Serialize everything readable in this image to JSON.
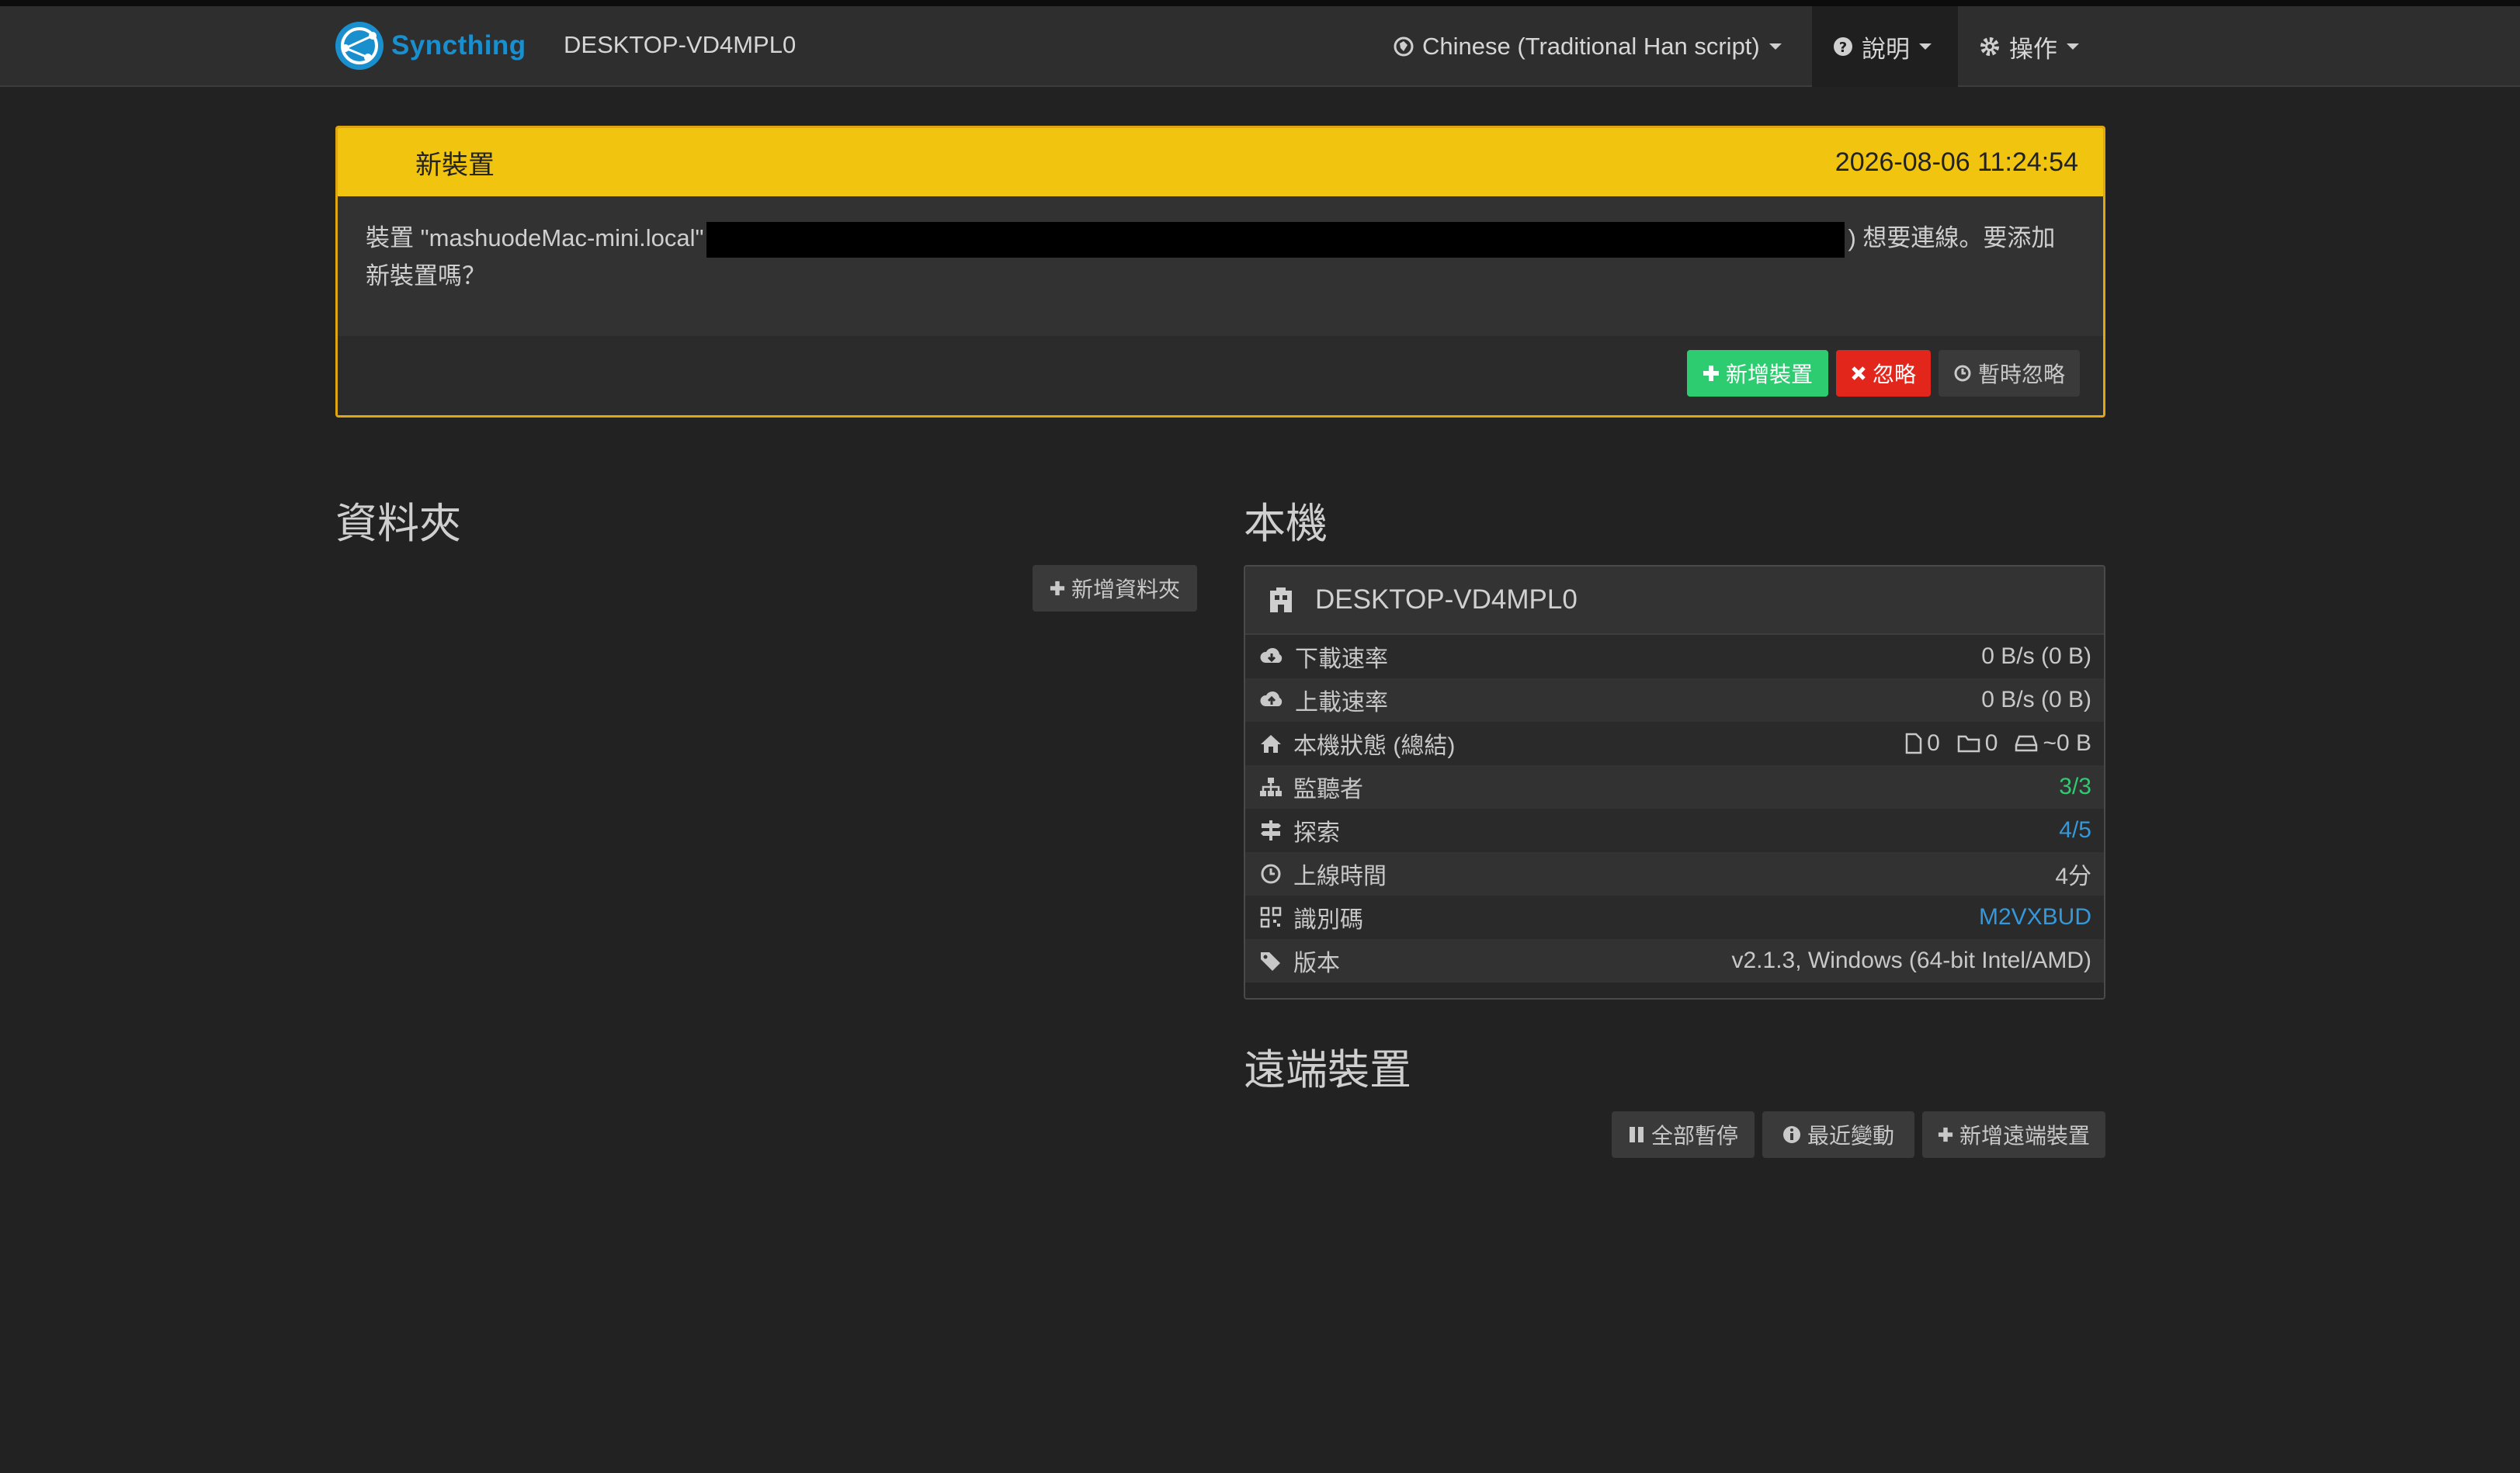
{
  "navbar": {
    "brand": "Syncthing",
    "host": "DESKTOP-VD4MPL0",
    "language_label": "Chinese (Traditional Han script)",
    "help_label": "說明",
    "actions_label": "操作"
  },
  "notice": {
    "title": "新裝置",
    "timestamp": "2026-08-06 11:24:54",
    "message_prefix": "裝置 \"mashuodeMac-mini.local\"",
    "message_suffix": ") 想要連線。要添加",
    "message_line2": "新裝置嗎？",
    "add_button": "新增裝置",
    "ignore_button": "忽略",
    "dismiss_button": "暫時忽略"
  },
  "folders": {
    "heading": "資料夾",
    "add_button": "新增資料夾"
  },
  "this_device": {
    "heading": "本機",
    "name": "DESKTOP-VD4MPL0",
    "rows": [
      {
        "label": "下載速率",
        "value": "0 B/s (0 B)",
        "icon": "cloud-download-icon"
      },
      {
        "label": "上載速率",
        "value": "0 B/s (0 B)",
        "icon": "cloud-upload-icon"
      },
      {
        "label": "本機狀態 (總結)",
        "icon": "home-icon",
        "files": "0",
        "dirs": "0",
        "size": "~0 B"
      },
      {
        "label": "監聽者",
        "value": "3/3",
        "icon": "sitemap-icon"
      },
      {
        "label": "探索",
        "value": "4/5",
        "icon": "signpost-icon"
      },
      {
        "label": "上線時間",
        "value": "4分",
        "icon": "clock-icon"
      },
      {
        "label": "識別碼",
        "value": "M2VXBUD",
        "icon": "qrcode-icon"
      },
      {
        "label": "版本",
        "value": "v2.1.3, Windows (64-bit Intel/AMD)",
        "icon": "tag-icon"
      }
    ]
  },
  "remote_devices": {
    "heading": "遠端裝置",
    "pause_all": "全部暫停",
    "recent_changes": "最近變動",
    "add_remote": "新增遠端裝置"
  },
  "colors": {
    "accent_blue": "#1a8fce",
    "warning_yellow": "#f1c40f",
    "success_green": "#2ecc71",
    "danger_red": "#e3261b",
    "link_blue": "#3498db"
  }
}
